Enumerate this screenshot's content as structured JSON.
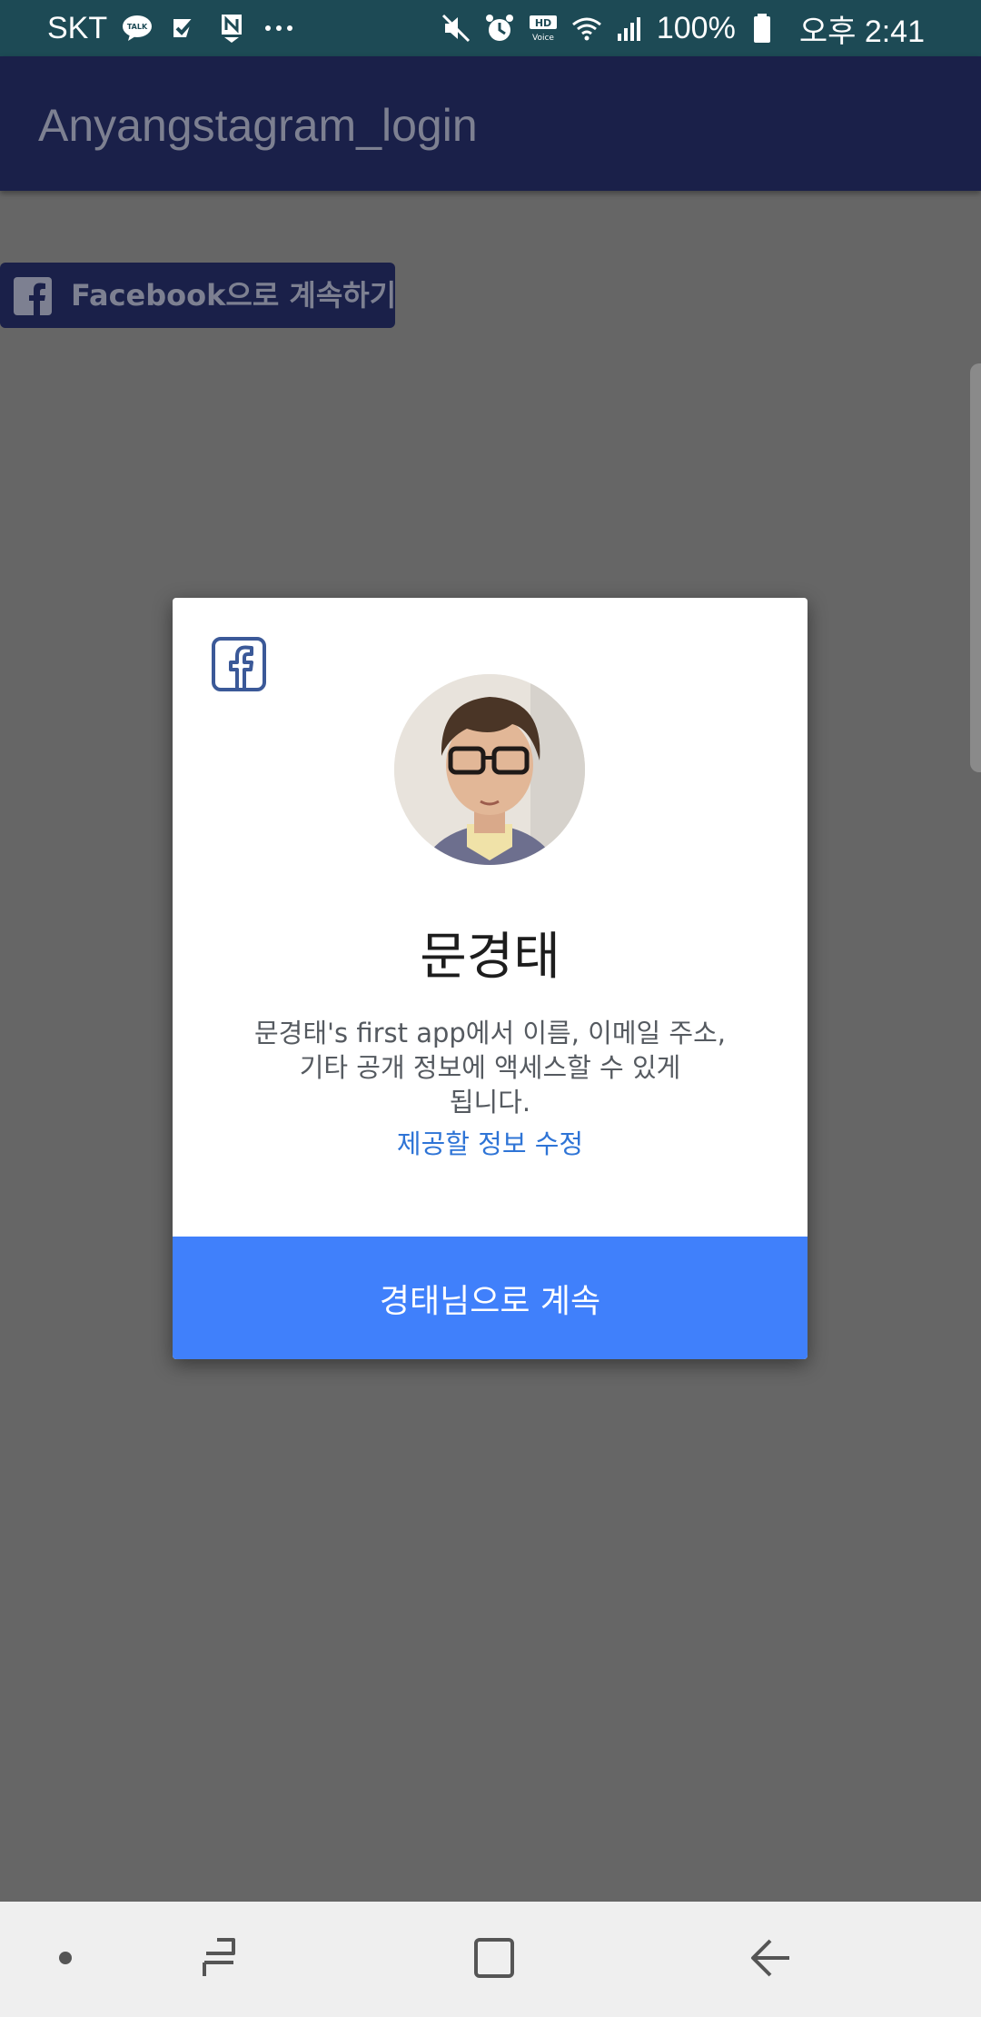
{
  "status_bar": {
    "carrier": "SKT",
    "notification_icons": [
      "kakaotalk-icon",
      "check-app-icon",
      "naver-icon",
      "more-dots-icon"
    ],
    "system_icons": [
      "mute-icon",
      "alarm-icon",
      "hd-voice-icon",
      "wifi-icon",
      "signal-icon"
    ],
    "hd_top": "HD",
    "hd_bottom": "Voice",
    "talk_label": "TALK",
    "battery_percent": "100%",
    "clock": "오후 2:41"
  },
  "app_bar": {
    "title": "Anyangstagram_login"
  },
  "fb_login_button": {
    "label": "Facebook으로 계속하기"
  },
  "dialog": {
    "user_name": "문경태",
    "permission_line1": "문경태's first app에서 이름, 이메일 주소,",
    "permission_line2": "기타 공개 정보에 액세스할 수 있게",
    "permission_line3": "됩니다.",
    "edit_info_link": "제공할 정보 수정",
    "continue_button": "경태님으로 계속"
  },
  "nav_bar": {
    "buttons": [
      "dot-icon",
      "recents-icon",
      "home-icon",
      "back-icon"
    ]
  },
  "colors": {
    "status_bar_bg": "#1d4a55",
    "app_bar_bg": "#1a2049",
    "scrim_bg": "#666666",
    "primary_blue": "#4080fb",
    "link_blue": "#2e74d6",
    "facebook_blue": "#3b5998"
  }
}
